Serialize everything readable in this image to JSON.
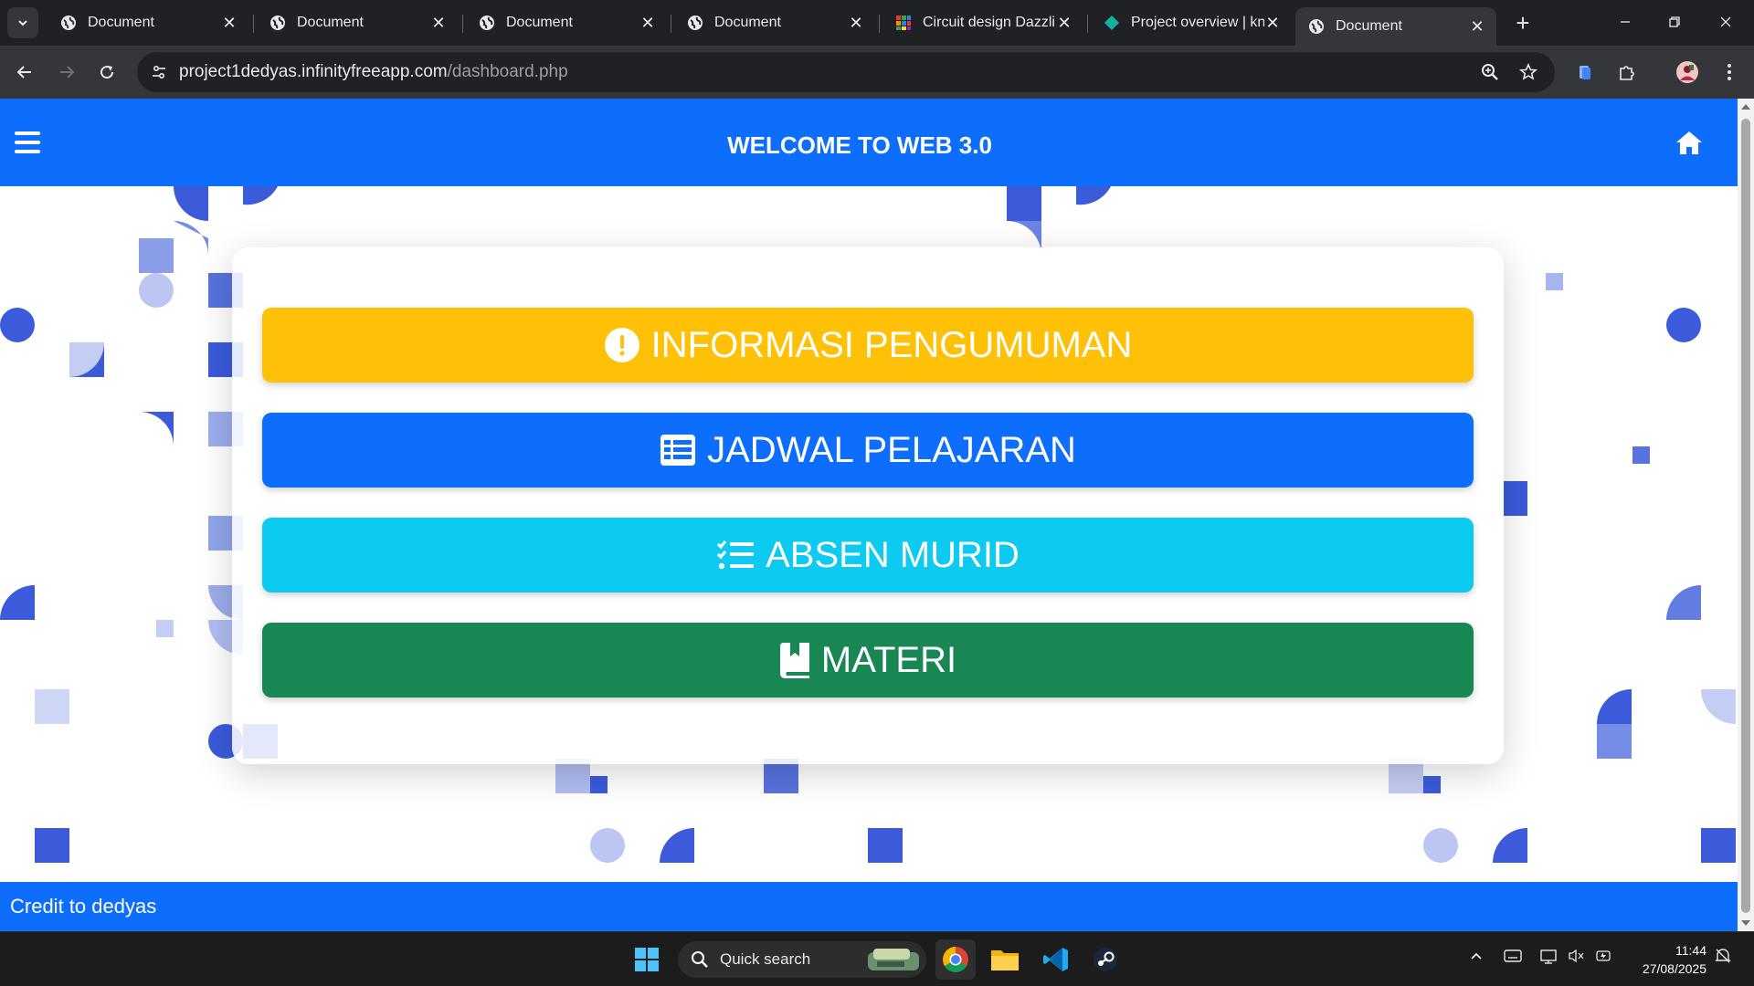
{
  "browser": {
    "tabs": [
      {
        "title": "Document",
        "favicon": "globe-icon",
        "active": false
      },
      {
        "title": "Document",
        "favicon": "globe-icon",
        "active": false
      },
      {
        "title": "Document",
        "favicon": "globe-icon",
        "active": false
      },
      {
        "title": "Document",
        "favicon": "globe-icon",
        "active": false
      },
      {
        "title": "Circuit design Dazzlin",
        "favicon": "tinkercad-icon",
        "active": false
      },
      {
        "title": "Project overview | kn",
        "favicon": "diamond-icon",
        "active": false
      },
      {
        "title": "Document",
        "favicon": "globe-icon",
        "active": true
      }
    ],
    "url_host": "project1dedyas.infinityfreeapp.com",
    "url_path": "/dashboard.php"
  },
  "page": {
    "nav_title": "WELCOME TO WEB 3.0",
    "buttons": [
      {
        "label": "INFORMASI PENGUMUMAN",
        "icon": "exclamation-circle-icon",
        "color": "#ffc107"
      },
      {
        "label": "JADWAL PELAJARAN",
        "icon": "table-list-icon",
        "color": "#0d6efd"
      },
      {
        "label": "ABSEN MURID",
        "icon": "list-check-icon",
        "color": "#0dcaf0"
      },
      {
        "label": "MATERI",
        "icon": "book-bookmark-icon",
        "color": "#198754"
      }
    ],
    "footer_text": "Credit to dedyas"
  },
  "taskbar": {
    "search_placeholder": "Quick search",
    "time": "11:44",
    "date": "27/08/2025"
  },
  "colors": {
    "primary": "#0d6efd",
    "warning": "#ffc107",
    "info": "#0dcaf0",
    "success": "#198754",
    "deco": "#3b5bdb"
  }
}
